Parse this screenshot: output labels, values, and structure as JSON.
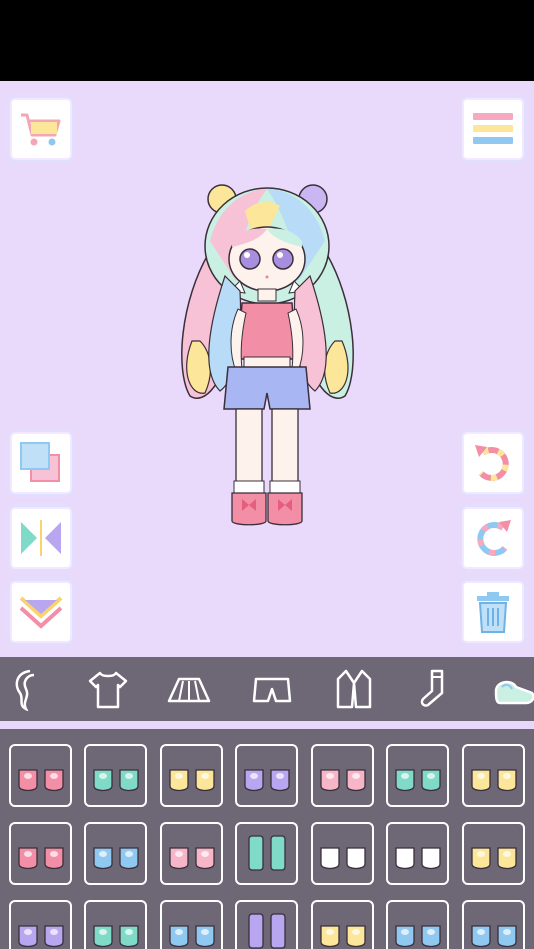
{
  "colors": {
    "stage_bg": "#e9dafc",
    "panel_bg": "#6d6776",
    "accent_pink": "#f28fa6",
    "accent_mint": "#7fdac8",
    "accent_yellow": "#fbe69a",
    "accent_blue": "#8fc8f0",
    "accent_lilac": "#b9a6f0"
  },
  "top_buttons": [
    "shop-cart-icon",
    "menu-icon"
  ],
  "left_buttons": [
    "layer-icon",
    "flip-icon",
    "move-down-icon"
  ],
  "right_buttons": [
    "undo-icon",
    "redo-icon",
    "trash-icon"
  ],
  "tabs": [
    "hair-icon",
    "top-icon",
    "skirt-icon",
    "shorts-icon",
    "jacket-icon",
    "socks-icon",
    "shoes-icon"
  ],
  "shoe_items": [
    {
      "icon": "pink-bow-shoes-icon",
      "color": "#f28fa6"
    },
    {
      "icon": "mint-slippers-icon",
      "color": "#7fdac8"
    },
    {
      "icon": "yellow-strap-sandals-icon",
      "color": "#fbe69a"
    },
    {
      "icon": "lilac-fluffy-boots-icon",
      "color": "#b9a6f0"
    },
    {
      "icon": "pink-flats-icon",
      "color": "#f7b6c8"
    },
    {
      "icon": "mint-heart-shoes-icon",
      "color": "#7fdac8"
    },
    {
      "icon": "yellow-shoes-icon",
      "color": "#fbe69a"
    },
    {
      "icon": "pink-ballet-flats-icon",
      "color": "#f28fa6"
    },
    {
      "icon": "blue-heart-boots-icon",
      "color": "#8fc8f0"
    },
    {
      "icon": "pink-lace-boots-icon",
      "color": "#f7b6c8"
    },
    {
      "icon": "mint-lace-boots-icon",
      "color": "#7fdac8"
    },
    {
      "icon": "white-ribbon-boots-icon",
      "color": "#ffffff"
    },
    {
      "icon": "white-pink-boots-icon",
      "color": "#ffffff"
    },
    {
      "icon": "yellow-frill-boots-icon",
      "color": "#fbe69a"
    },
    {
      "icon": "lilac-flats-icon",
      "color": "#b9a6f0"
    },
    {
      "icon": "mint-sneakers-icon",
      "color": "#7fdac8"
    },
    {
      "icon": "blue-mary-janes-icon",
      "color": "#8fc8f0"
    },
    {
      "icon": "lilac-knee-boots-icon",
      "color": "#b9a6f0"
    },
    {
      "icon": "yellow-loafers-icon",
      "color": "#fbe69a"
    },
    {
      "icon": "blue-pink-boots-icon",
      "color": "#8fc8f0"
    },
    {
      "icon": "blue-sneakers-icon",
      "color": "#8fc8f0"
    }
  ]
}
